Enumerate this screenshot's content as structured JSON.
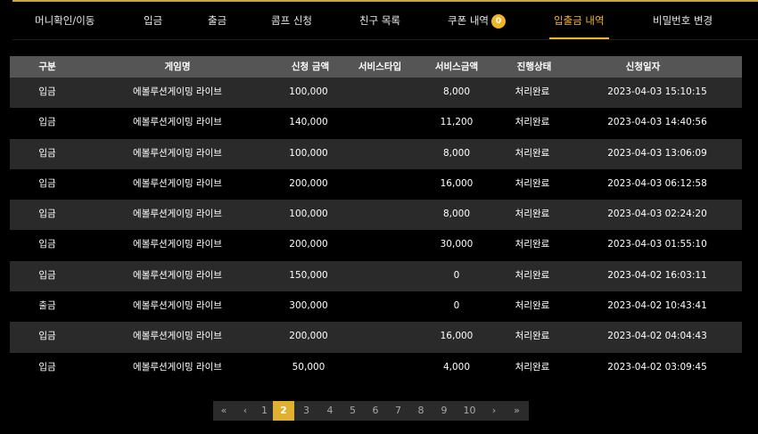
{
  "tabs": [
    {
      "label": "머니확인/이동"
    },
    {
      "label": "입금"
    },
    {
      "label": "출금"
    },
    {
      "label": "콤프 신청"
    },
    {
      "label": "친구 목록"
    },
    {
      "label": "쿠폰 내역",
      "badge": "0"
    },
    {
      "label": "입출금 내역",
      "active": true
    },
    {
      "label": "비밀번호 변경"
    }
  ],
  "table": {
    "headers": [
      "구분",
      "게임명",
      "신청 금액",
      "서비스타입",
      "서비스금액",
      "진행상태",
      "신청일자"
    ],
    "rows": [
      [
        "입금",
        "에볼루션게이밍 라이브",
        "100,000",
        "",
        "8,000",
        "처리완료",
        "2023-04-03 15:10:15"
      ],
      [
        "입금",
        "에볼루션게이밍 라이브",
        "140,000",
        "",
        "11,200",
        "처리완료",
        "2023-04-03 14:40:56"
      ],
      [
        "입금",
        "에볼루션게이밍 라이브",
        "100,000",
        "",
        "8,000",
        "처리완료",
        "2023-04-03 13:06:09"
      ],
      [
        "입금",
        "에볼루션게이밍 라이브",
        "200,000",
        "",
        "16,000",
        "처리완료",
        "2023-04-03 06:12:58"
      ],
      [
        "입금",
        "에볼루션게이밍 라이브",
        "100,000",
        "",
        "8,000",
        "처리완료",
        "2023-04-03 02:24:20"
      ],
      [
        "입금",
        "에볼루션게이밍 라이브",
        "200,000",
        "",
        "30,000",
        "처리완료",
        "2023-04-03 01:55:10"
      ],
      [
        "입금",
        "에볼루션게이밍 라이브",
        "150,000",
        "",
        "0",
        "처리완료",
        "2023-04-02 16:03:11"
      ],
      [
        "출금",
        "에볼루션게이밍 라이브",
        "300,000",
        "",
        "0",
        "처리완료",
        "2023-04-02 10:43:41"
      ],
      [
        "입금",
        "에볼루션게이밍 라이브",
        "200,000",
        "",
        "16,000",
        "처리완료",
        "2023-04-02 04:04:43"
      ],
      [
        "입금",
        "에볼루션게이밍 라이브",
        "50,000",
        "",
        "4,000",
        "처리완료",
        "2023-04-02 03:09:45"
      ]
    ]
  },
  "pagination": {
    "first": "«",
    "prev": "‹",
    "pages": [
      "1",
      "2",
      "3",
      "4",
      "5",
      "6",
      "7",
      "8",
      "9",
      "10"
    ],
    "current": "2",
    "next": "›",
    "last": "»"
  },
  "colors": {
    "accent": "#f0b429",
    "header_bg": "#555555",
    "row_alt_bg": "#2a2a2a",
    "background": "#000000"
  }
}
